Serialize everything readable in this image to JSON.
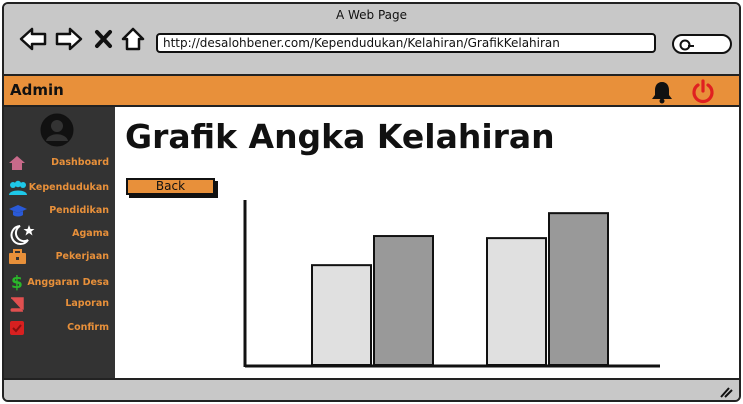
{
  "window": {
    "title": "A Web Page"
  },
  "browser": {
    "url": "http://desalohbener.com/Kependudukan/Kelahiran/GrafikKelahiran"
  },
  "topbar": {
    "user_label": "Admin"
  },
  "sidebar": {
    "items": [
      {
        "label": "Dashboard",
        "icon": "home-icon",
        "color": "#c86a8a"
      },
      {
        "label": "Kependudukan",
        "icon": "users-icon",
        "color": "#1ec8e8"
      },
      {
        "label": "Pendidikan",
        "icon": "graduation-cap-icon",
        "color": "#2a5ad8"
      },
      {
        "label": "Agama",
        "icon": "moon-star-icon",
        "color": "#ffffff"
      },
      {
        "label": "Pekerjaan",
        "icon": "briefcase-icon",
        "color": "#e8903a"
      },
      {
        "label": "Anggaran Desa",
        "icon": "dollar-icon",
        "color": "#2ab82a"
      },
      {
        "label": "Laporan",
        "icon": "book-icon",
        "color": "#e05050"
      },
      {
        "label": "Confirm",
        "icon": "check-square-icon",
        "color": "#d82020"
      }
    ]
  },
  "main": {
    "title": "Grafik Angka Kelahiran",
    "back_label": "Back"
  },
  "colors": {
    "accent": "#e8903a",
    "sidebar_bg": "#333333",
    "power": "#e02020"
  },
  "chart_data": {
    "type": "bar",
    "categories": [
      "",
      ""
    ],
    "series": [
      {
        "values": [
          48,
          61
        ],
        "color": "#e0e0e0"
      },
      {
        "values": [
          62,
          73
        ],
        "color": "#999999"
      }
    ],
    "ylim": [
      0,
      100
    ],
    "title": "",
    "xlabel": "",
    "ylabel": "",
    "grid": false
  }
}
